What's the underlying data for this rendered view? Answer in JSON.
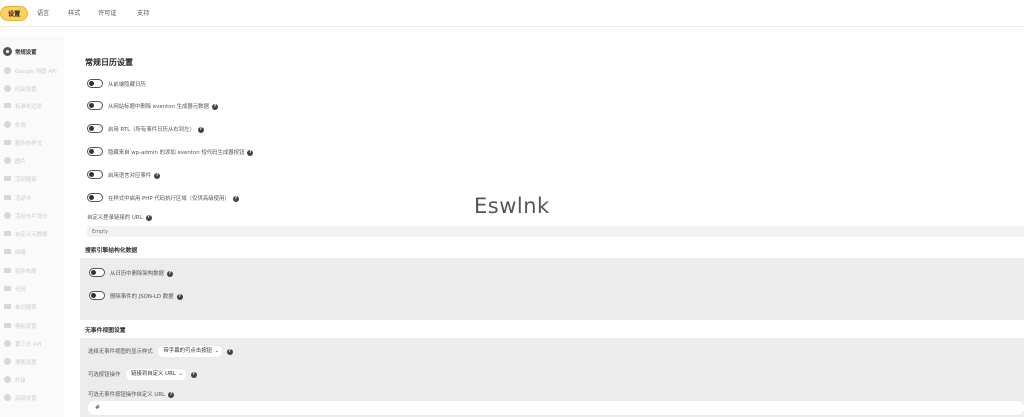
{
  "top_tabs": [
    "设置",
    "语言",
    "样式",
    "许可证",
    "支持"
  ],
  "sidebar": {
    "items": [
      {
        "label": "常规设置",
        "active": true,
        "icon": "gear-icon"
      },
      {
        "label": "Google 地图 API",
        "icon": "map-pin-icon"
      },
      {
        "label": "时间设置",
        "icon": "clock-icon"
      },
      {
        "label": "标准化过滤",
        "icon": "filter-icon"
      },
      {
        "label": "外观",
        "icon": "eye-icon"
      },
      {
        "label": "额外的样式",
        "icon": "brush-icon"
      },
      {
        "label": "图片",
        "icon": "image-icon"
      },
      {
        "label": "活动链接",
        "icon": "calendar-icon"
      },
      {
        "label": "活动卡",
        "icon": "card-icon"
      },
      {
        "label": "活动卡片设计",
        "icon": "tools-icon"
      },
      {
        "label": "自定义元数据",
        "icon": "list-icon"
      },
      {
        "label": "网格",
        "icon": "chart-icon"
      },
      {
        "label": "组件布局",
        "icon": "document-icon"
      },
      {
        "label": "代码",
        "icon": "code-icon"
      },
      {
        "label": "单词搜索",
        "icon": "calendar-icon"
      },
      {
        "label": "模板设置",
        "icon": "template-icon"
      },
      {
        "label": "第三方 API",
        "icon": "plug-icon"
      },
      {
        "label": "搜索设置",
        "icon": "search-icon"
      },
      {
        "label": "升级",
        "icon": "rocket-icon"
      },
      {
        "label": "高级设置",
        "icon": "settings-icon"
      }
    ]
  },
  "main": {
    "section_title": "常规日历设置",
    "toggles": [
      {
        "label": "从前端隐藏日历",
        "help": false
      },
      {
        "label": "从网站标题中删除 eventon 生成器元数据",
        "help": true
      },
      {
        "label": "启用 RTL（所有事件日历从右到左）",
        "help": true
      },
      {
        "label": "隐藏来自 wp-admin 的添加 eventon 短代码生成器按钮",
        "help": true
      },
      {
        "label": "启用语言对应事件",
        "help": true
      },
      {
        "label": "在样式中启用 PHP 代码执行区域（仅供高级使用）",
        "help": true
      }
    ],
    "custom_url_label": "自定义登录链接的 URL",
    "custom_url_placeholder": "Empty",
    "schema_title": "搜索引擎结构化数据",
    "schema_toggles": [
      {
        "label": "从日历中删除架构数据"
      },
      {
        "label": "删除事件的 JSON-LD 数据"
      }
    ],
    "no_events_title": "无事件视图设置",
    "no_events_style_label": "选择无事件视图的显示样式",
    "no_events_style_value": "带字幕的可点击按钮",
    "button_action_label": "可选按钮操作",
    "button_action_value": "链接到自定义 URL",
    "custom_action_url_label": "可选无事件按钮操作自定义 URL",
    "custom_action_url_value": "#"
  },
  "watermark": "Eswlnk"
}
